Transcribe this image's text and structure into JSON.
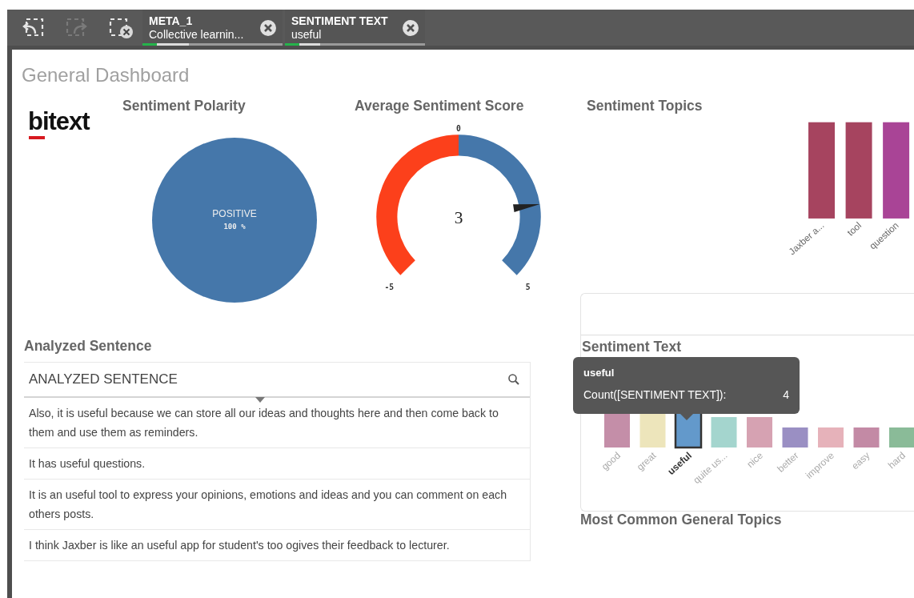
{
  "toolbar": {
    "buttons": [
      {
        "kind": "back",
        "disabled": false
      },
      {
        "kind": "forward",
        "disabled": true
      },
      {
        "kind": "clear",
        "disabled": false
      }
    ],
    "selections": [
      {
        "field": "META_1",
        "value": "Collective learnin...",
        "level": 0.33
      },
      {
        "field": "SENTIMENT TEXT",
        "value": "useful",
        "level": 0.25
      }
    ]
  },
  "sheet": {
    "title": "General Dashboard"
  },
  "logo": {
    "text": "bitext"
  },
  "polarity": {
    "title": "Sentiment Polarity",
    "chart_data": {
      "type": "pie",
      "categories": [
        "POSITIVE"
      ],
      "values": [
        100
      ],
      "value_labels": [
        "100 %"
      ]
    }
  },
  "gauge": {
    "title": "Average Sentiment Score",
    "value": "3",
    "min": "-5",
    "mid": "0",
    "max": "5"
  },
  "topics": {
    "title": "Sentiment Topics",
    "bars": [
      {
        "label": "Jaxber a...",
        "color": "#a6445f"
      },
      {
        "label": "tool",
        "color": "#a6445f"
      },
      {
        "label": "question",
        "color": "#a94496"
      }
    ]
  },
  "sentences": {
    "title": "Analyzed Sentence",
    "header": "ANALYZED SENTENCE",
    "rows": [
      "Also, it is useful because we can store all our ideas and thoughts here and then come back to them and use them as reminders.",
      "It has useful questions.",
      "It is an useful tool to express your opinions, emotions and ideas and you can comment on each others posts.",
      "I think Jaxber is like an useful app for student's too ogives their feedback to lecturer."
    ]
  },
  "sentiment_text": {
    "title": "Sentiment Text",
    "bars": [
      {
        "label": "good",
        "color": "#c48ea8",
        "selected": false
      },
      {
        "label": "great",
        "color": "#ede5bb",
        "selected": false
      },
      {
        "label": "useful",
        "color": "#6399cb",
        "selected": true
      },
      {
        "label": "quite us...",
        "color": "#a4d5ce",
        "selected": false
      },
      {
        "label": "nice",
        "color": "#d6a2b2",
        "selected": false
      },
      {
        "label": "better",
        "color": "#9a8fc3",
        "selected": false
      },
      {
        "label": "improve",
        "color": "#e6b2ba",
        "selected": false
      },
      {
        "label": "easy",
        "color": "#c38aa5",
        "selected": false
      },
      {
        "label": "hard",
        "color": "#8abb98",
        "selected": false
      }
    ],
    "tooltip": {
      "title": "useful",
      "measure": "Count([SENTIMENT TEXT]):",
      "value": "4"
    }
  },
  "general_topics": {
    "title": "Most Common General Topics"
  }
}
